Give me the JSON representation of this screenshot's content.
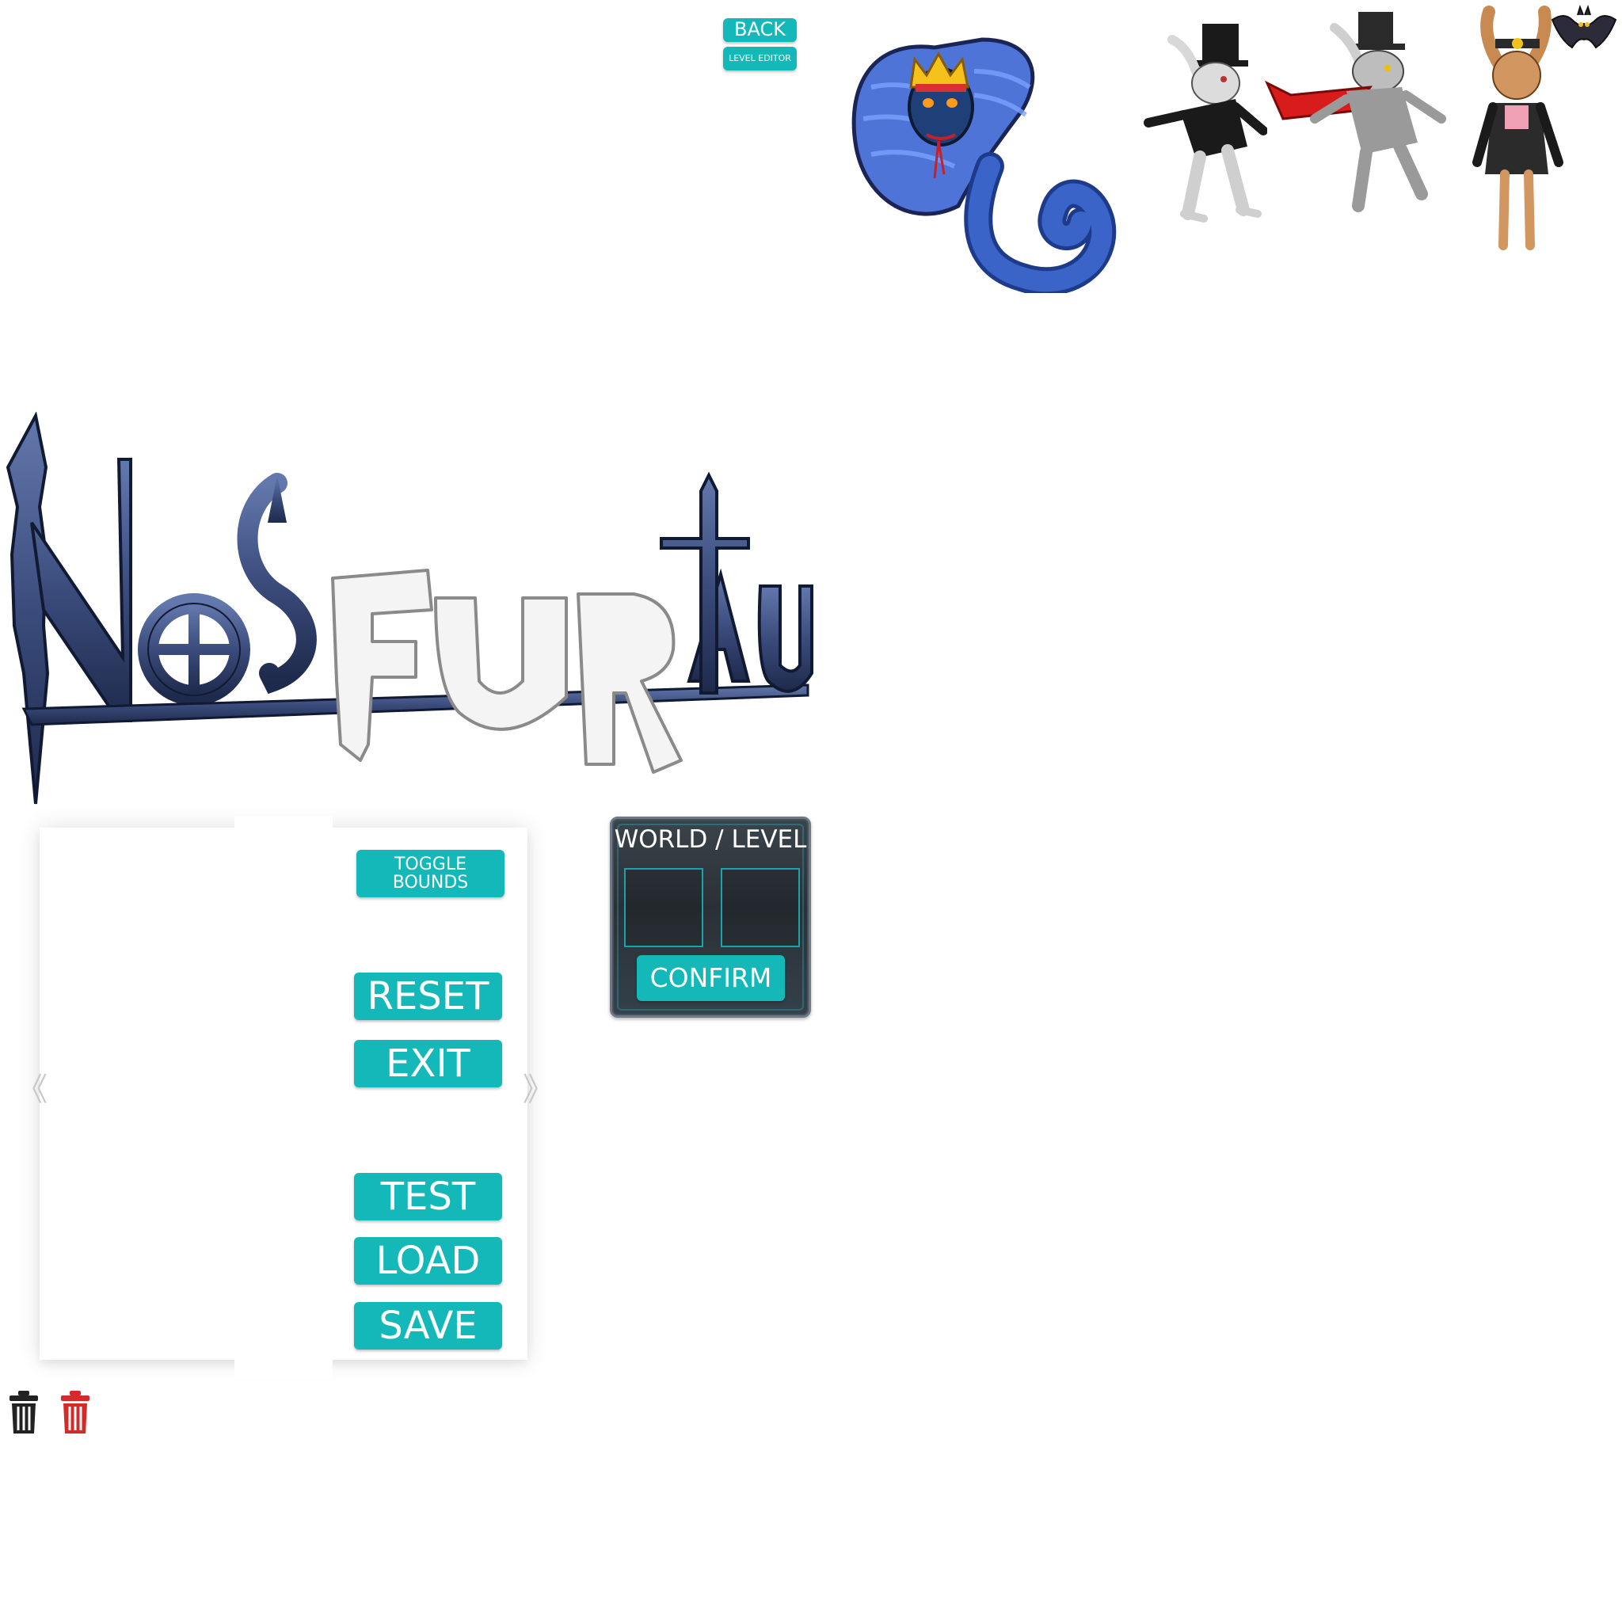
{
  "header": {
    "back_label": "BACK",
    "level_editor_label": "LEVEL EDITOR"
  },
  "characters": [
    {
      "name": "cobra-king"
    },
    {
      "name": "top-hat-rabbit"
    },
    {
      "name": "vampire-rabbit"
    },
    {
      "name": "bunny-girl"
    },
    {
      "name": "bat"
    }
  ],
  "logo": {
    "text": "NOSFURATU",
    "colors": {
      "stone": "#3d4e7e",
      "fur": "#f2f2f2"
    }
  },
  "editor": {
    "toggle_bounds_line1": "TOGGLE",
    "toggle_bounds_line2": "BOUNDS",
    "reset_label": "RESET",
    "exit_label": "EXIT",
    "test_label": "TEST",
    "load_label": "LOAD",
    "save_label": "SAVE",
    "prev_arrow": "《",
    "next_arrow": "》"
  },
  "world_dialog": {
    "title": "WORLD / LEVEL",
    "confirm_label": "CONFIRM",
    "world_value": "",
    "level_value": ""
  },
  "trash": [
    {
      "name": "trash-icon-dark",
      "color": "#222222"
    },
    {
      "name": "trash-icon-red",
      "color": "#d42a2a"
    }
  ],
  "colors": {
    "button": "#14b8b8",
    "button_text": "#ffffff",
    "dialog_bg": "#2e353c",
    "dialog_border": "#6f7a86"
  }
}
